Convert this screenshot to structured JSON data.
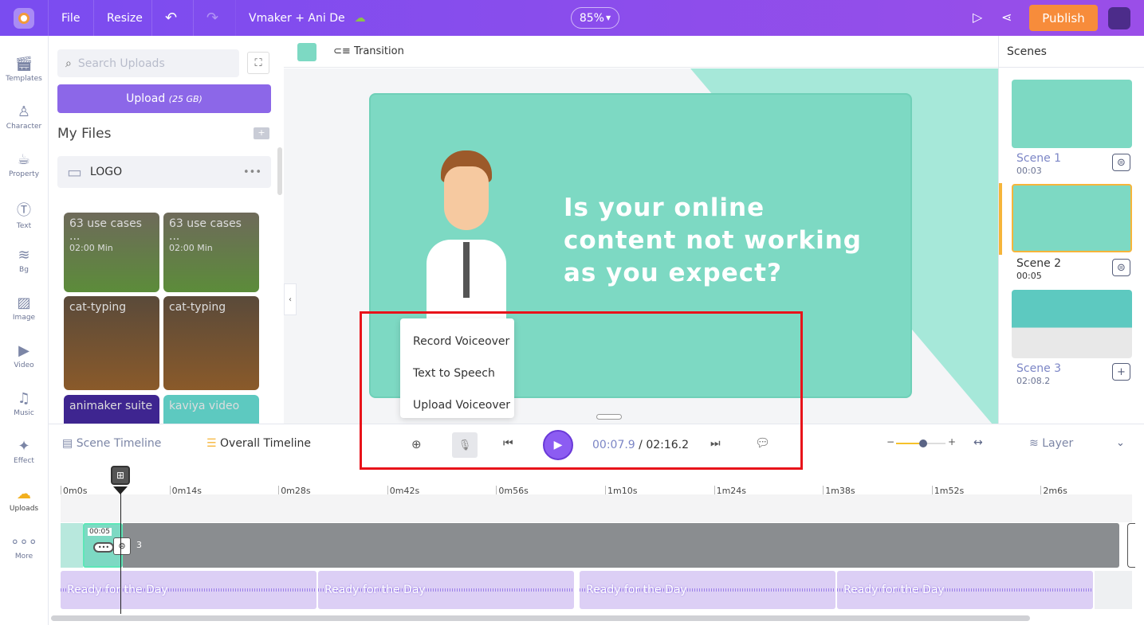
{
  "topbar": {
    "file": "File",
    "resize": "Resize",
    "project_title": "Vmaker + Ani De",
    "zoom": "85%",
    "publish": "Publish"
  },
  "rail": [
    "Templates",
    "Character",
    "Property",
    "Text",
    "Bg",
    "Image",
    "Video",
    "Music",
    "Effect",
    "Uploads",
    "More"
  ],
  "uploads": {
    "search_placeholder": "Search Uploads",
    "upload_label": "Upload",
    "upload_quota": "(25 GB)",
    "my_files": "My Files",
    "folder": "LOGO",
    "items": [
      {
        "title": "63 use cases ...",
        "duration": "02:00 Min"
      },
      {
        "title": "63 use cases ...",
        "duration": "02:00 Min"
      },
      {
        "title": "cat-typing"
      },
      {
        "title": "cat-typing"
      },
      {
        "title": "animaker suite"
      },
      {
        "title": "kaviya video"
      }
    ]
  },
  "canvas": {
    "transition": "Transition",
    "headline": "Is your online content not working as you expect?",
    "bg_color": "#7dd9c3"
  },
  "voice_menu": [
    "Record Voiceover",
    "Text to Speech",
    "Upload Voiceover"
  ],
  "scenes": {
    "title": "Scenes",
    "list": [
      {
        "name": "Scene 1",
        "time": "00:03"
      },
      {
        "name": "Scene 2",
        "time": "00:05"
      },
      {
        "name": "Scene 3",
        "time": "02:08.2"
      }
    ]
  },
  "timeline": {
    "scene_timeline": "Scene Timeline",
    "overall_timeline": "Overall Timeline",
    "current": "00:07.9",
    "total": "02:16.2",
    "layer": "Layer",
    "ticks": [
      "0m0s",
      "0m14s",
      "0m28s",
      "0m42s",
      "0m56s",
      "1m10s",
      "1m24s",
      "1m38s",
      "1m52s",
      "2m6s"
    ],
    "scene_clip_time": "00:05",
    "scene_number": "3",
    "audio": [
      "Ready for the Day",
      "Ready for the Day",
      "Ready for the Day",
      "Ready for the Day"
    ],
    "zoom_level": 0.55
  }
}
